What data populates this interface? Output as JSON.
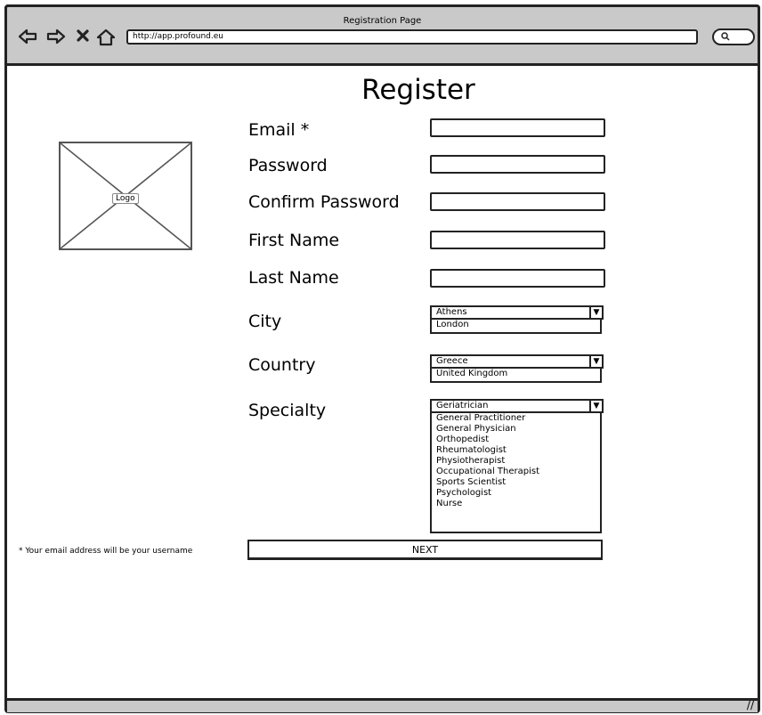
{
  "window": {
    "title": "Registration Page",
    "url": "http://app.profound.eu"
  },
  "page": {
    "heading": "Register",
    "logo_label": "Logo",
    "footnote": "* Your email address will be your username"
  },
  "form": {
    "email_label": "Email *",
    "password_label": "Password",
    "confirm_password_label": "Confirm Password",
    "first_name_label": "First Name",
    "last_name_label": "Last Name",
    "city_label": "City",
    "country_label": "Country",
    "specialty_label": "Specialty",
    "city": {
      "selected": "Athens",
      "options": [
        "London"
      ]
    },
    "country": {
      "selected": "Greece",
      "options": [
        "United Kingdom"
      ]
    },
    "specialty": {
      "selected": "Geriatrician",
      "options": [
        "General Practitioner",
        "General Physician",
        "Orthopedist",
        "Rheumatologist",
        "Physiotherapist",
        "Occupational Therapist",
        "Sports Scientist",
        "Psychologist",
        "Nurse"
      ]
    },
    "next_label": "NEXT"
  },
  "icons": {
    "back": "back-arrow-icon",
    "forward": "forward-arrow-icon",
    "stop": "close-icon",
    "home": "home-icon",
    "search": "search-icon",
    "dropdown": "chevron-down-icon"
  }
}
